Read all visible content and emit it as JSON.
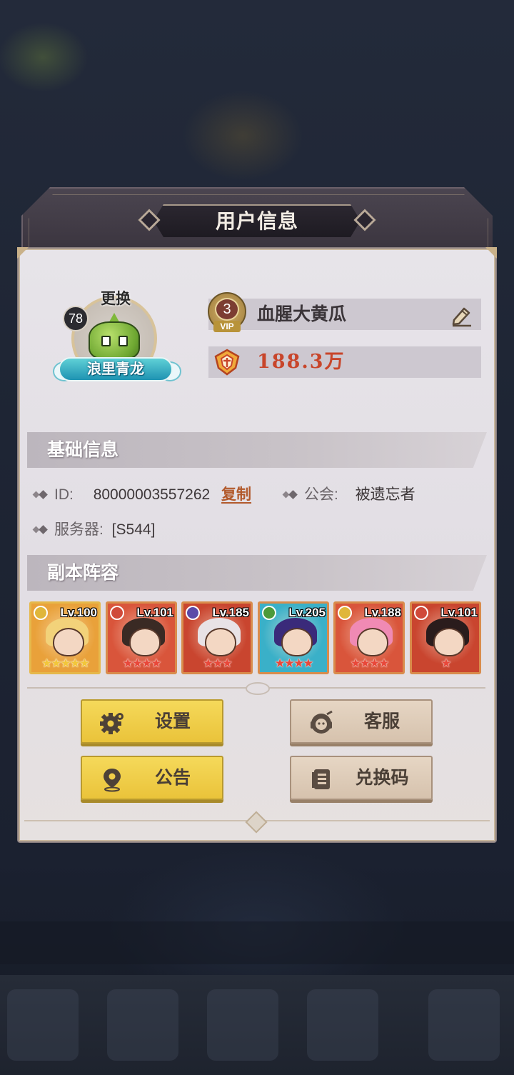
{
  "dialog": {
    "title": "用户信息"
  },
  "profile": {
    "level": "78",
    "change_label": "更换",
    "title_badge": "浪里青龙",
    "vip_level": "3",
    "vip_tag": "VIP",
    "name": "血腥大黄瓜",
    "power": "188.3万"
  },
  "basic_info": {
    "header": "基础信息",
    "id_label": "ID:",
    "id_value": "80000003557262",
    "copy_label": "复制",
    "guild_label": "公会:",
    "guild_value": "被遗忘者",
    "server_label": "服务器:",
    "server_value": "[S544]"
  },
  "lineup": {
    "header": "副本阵容",
    "heroes": [
      {
        "level": "Lv.100",
        "stars": "★★★★★",
        "star_color": "gold",
        "element": "#e0b63a",
        "bg": "#e9a13a",
        "hair": "#f2d27a"
      },
      {
        "level": "Lv.101",
        "stars": "★★★★",
        "star_color": "red",
        "element": "#d04a3a",
        "bg": "#d9553b",
        "hair": "#3a2a24"
      },
      {
        "level": "Lv.185",
        "stars": "★★★",
        "star_color": "red",
        "element": "#5b4aa8",
        "bg": "#c9452f",
        "hair": "#e8e2e6"
      },
      {
        "level": "Lv.205",
        "stars": "★★★★",
        "star_color": "red",
        "element": "#4c9a3a",
        "bg": "#3ab0c8",
        "hair": "#3a2a7a"
      },
      {
        "level": "Lv.188",
        "stars": "★★★★",
        "star_color": "red",
        "element": "#e0b63a",
        "bg": "#d9553b",
        "hair": "#f08ab4"
      },
      {
        "level": "Lv.101",
        "stars": "★",
        "star_color": "red",
        "element": "#d04a3a",
        "bg": "#c9452f",
        "hair": "#2a1c1c"
      }
    ]
  },
  "buttons": {
    "settings": "设置",
    "customer_service": "客服",
    "announcement": "公告",
    "redeem_code": "兑换码"
  },
  "icons": {
    "edit": "pencil-icon",
    "power": "power-crest-icon",
    "settings": "gear-icon",
    "customer_service": "headset-icon",
    "announcement": "location-pin-icon",
    "redeem_code": "document-icon"
  },
  "colors": {
    "primary_button": "#f0cd48",
    "secondary_button": "#dfcbb6",
    "power_text": "#c8452a",
    "copy_link": "#b25a2c"
  }
}
